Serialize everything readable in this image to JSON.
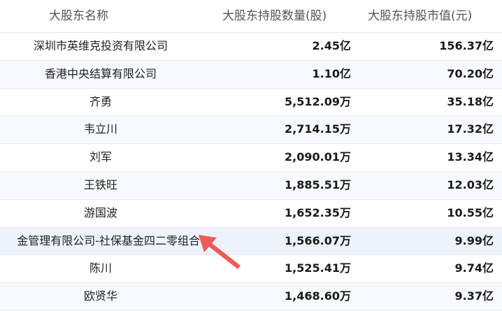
{
  "header": {
    "name": "大股东名称",
    "quantity": "大股东持股数量(股)",
    "value": "大股东持股市值(元)"
  },
  "rows": [
    {
      "name": "深圳市英维克投资有限公司",
      "quantity": "2.45亿",
      "value": "156.37亿"
    },
    {
      "name": "香港中央结算有限公司",
      "quantity": "1.10亿",
      "value": "70.20亿"
    },
    {
      "name": "齐勇",
      "quantity": "5,512.09万",
      "value": "35.18亿"
    },
    {
      "name": "韦立川",
      "quantity": "2,714.15万",
      "value": "17.32亿"
    },
    {
      "name": "刘军",
      "quantity": "2,090.01万",
      "value": "13.34亿"
    },
    {
      "name": "王铁旺",
      "quantity": "1,885.51万",
      "value": "12.03亿"
    },
    {
      "name": "游国波",
      "quantity": "1,652.35万",
      "value": "10.55亿"
    },
    {
      "name": "金管理有限公司-社保基金四二零组合",
      "quantity": "1,566.07万",
      "value": "9.99亿"
    },
    {
      "name": "陈川",
      "quantity": "1,525.41万",
      "value": "9.74亿"
    },
    {
      "name": "欧贤华",
      "quantity": "1,468.60万",
      "value": "9.37亿"
    }
  ],
  "colors": {
    "arrow": "#ee5b5b",
    "highlight_row": "#eef3fb"
  }
}
